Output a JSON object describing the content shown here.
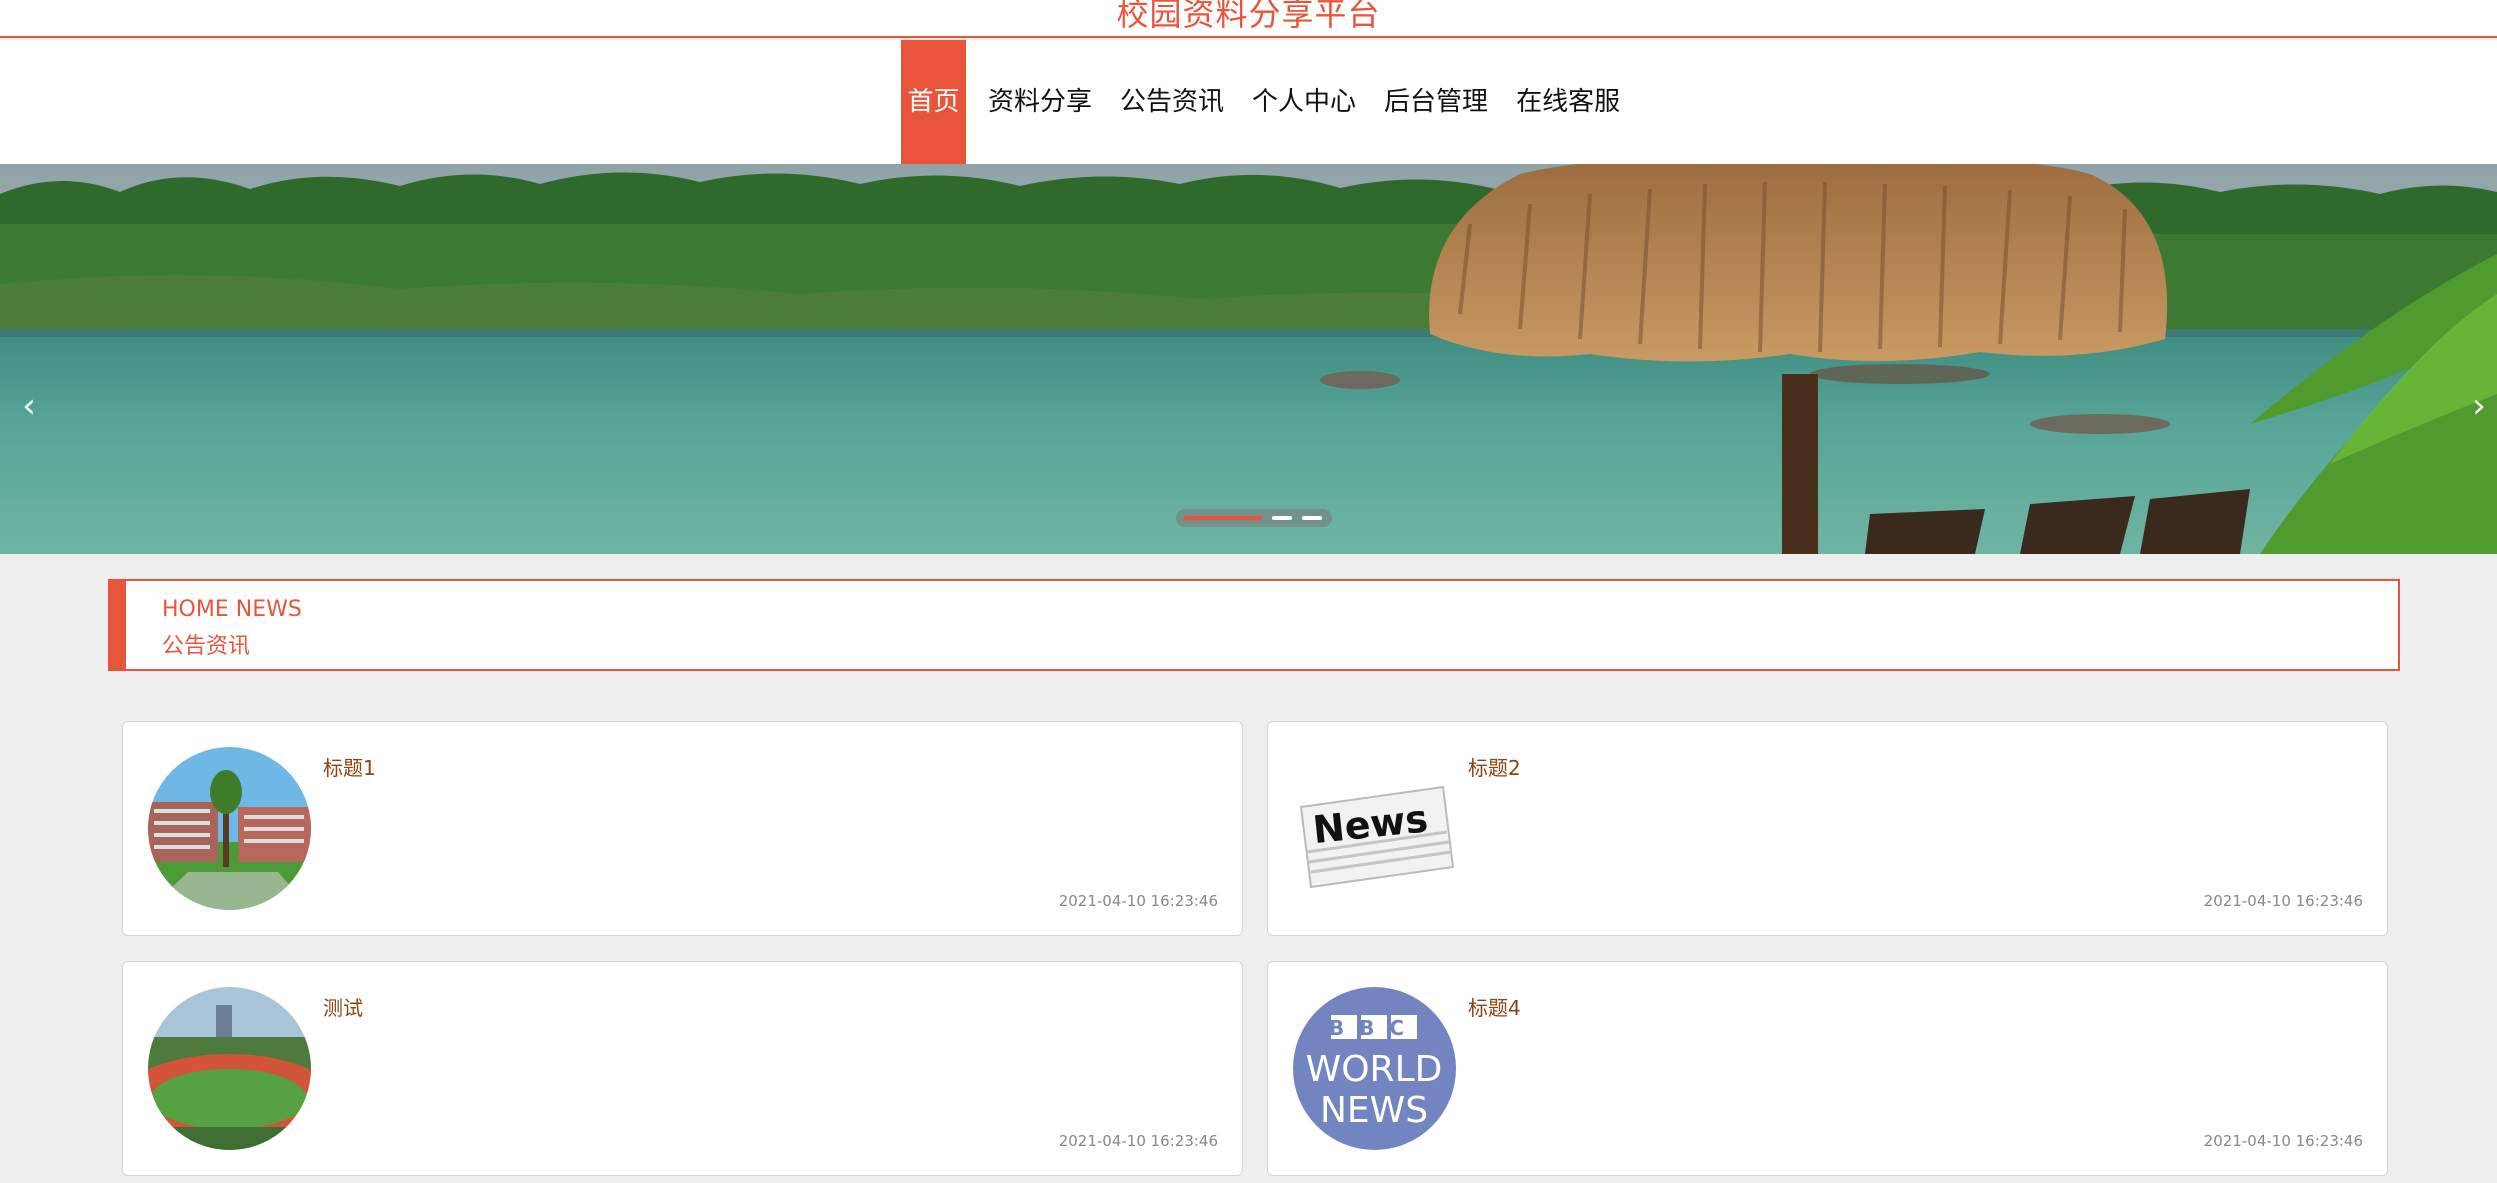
{
  "site": {
    "title": "校园资料分享平台"
  },
  "nav": {
    "items": [
      {
        "label": "首页",
        "active": true
      },
      {
        "label": "资料分享"
      },
      {
        "label": "公告资讯"
      },
      {
        "label": "个人中心"
      },
      {
        "label": "后台管理"
      },
      {
        "label": "在线客服"
      }
    ]
  },
  "banner": {
    "prev_icon": "chevron-left-icon",
    "next_icon": "chevron-right-icon",
    "prev_glyph": "‹",
    "next_glyph": "›",
    "slide_count": 3,
    "active_slide": 1
  },
  "section": {
    "title_en": "HOME NEWS",
    "title_cn": "公告资讯"
  },
  "news": [
    {
      "title": "标题1",
      "time": "2021-04-10 16:23:46",
      "image": "campus-building"
    },
    {
      "title": "标题2",
      "time": "2021-04-10 16:23:46",
      "image": "newspaper",
      "image_text": "News"
    },
    {
      "title": "测试",
      "time": "2021-04-10 16:23:46",
      "image": "sports-field"
    },
    {
      "title": "标题4",
      "time": "2021-04-10 16:23:46",
      "image": "bbc-logo",
      "image_text": [
        "BBC",
        "WORLD",
        "NEWS"
      ]
    }
  ],
  "colors": {
    "accent": "#e8553a",
    "news_title": "#8b4513",
    "page_bg": "#eeeeee"
  }
}
